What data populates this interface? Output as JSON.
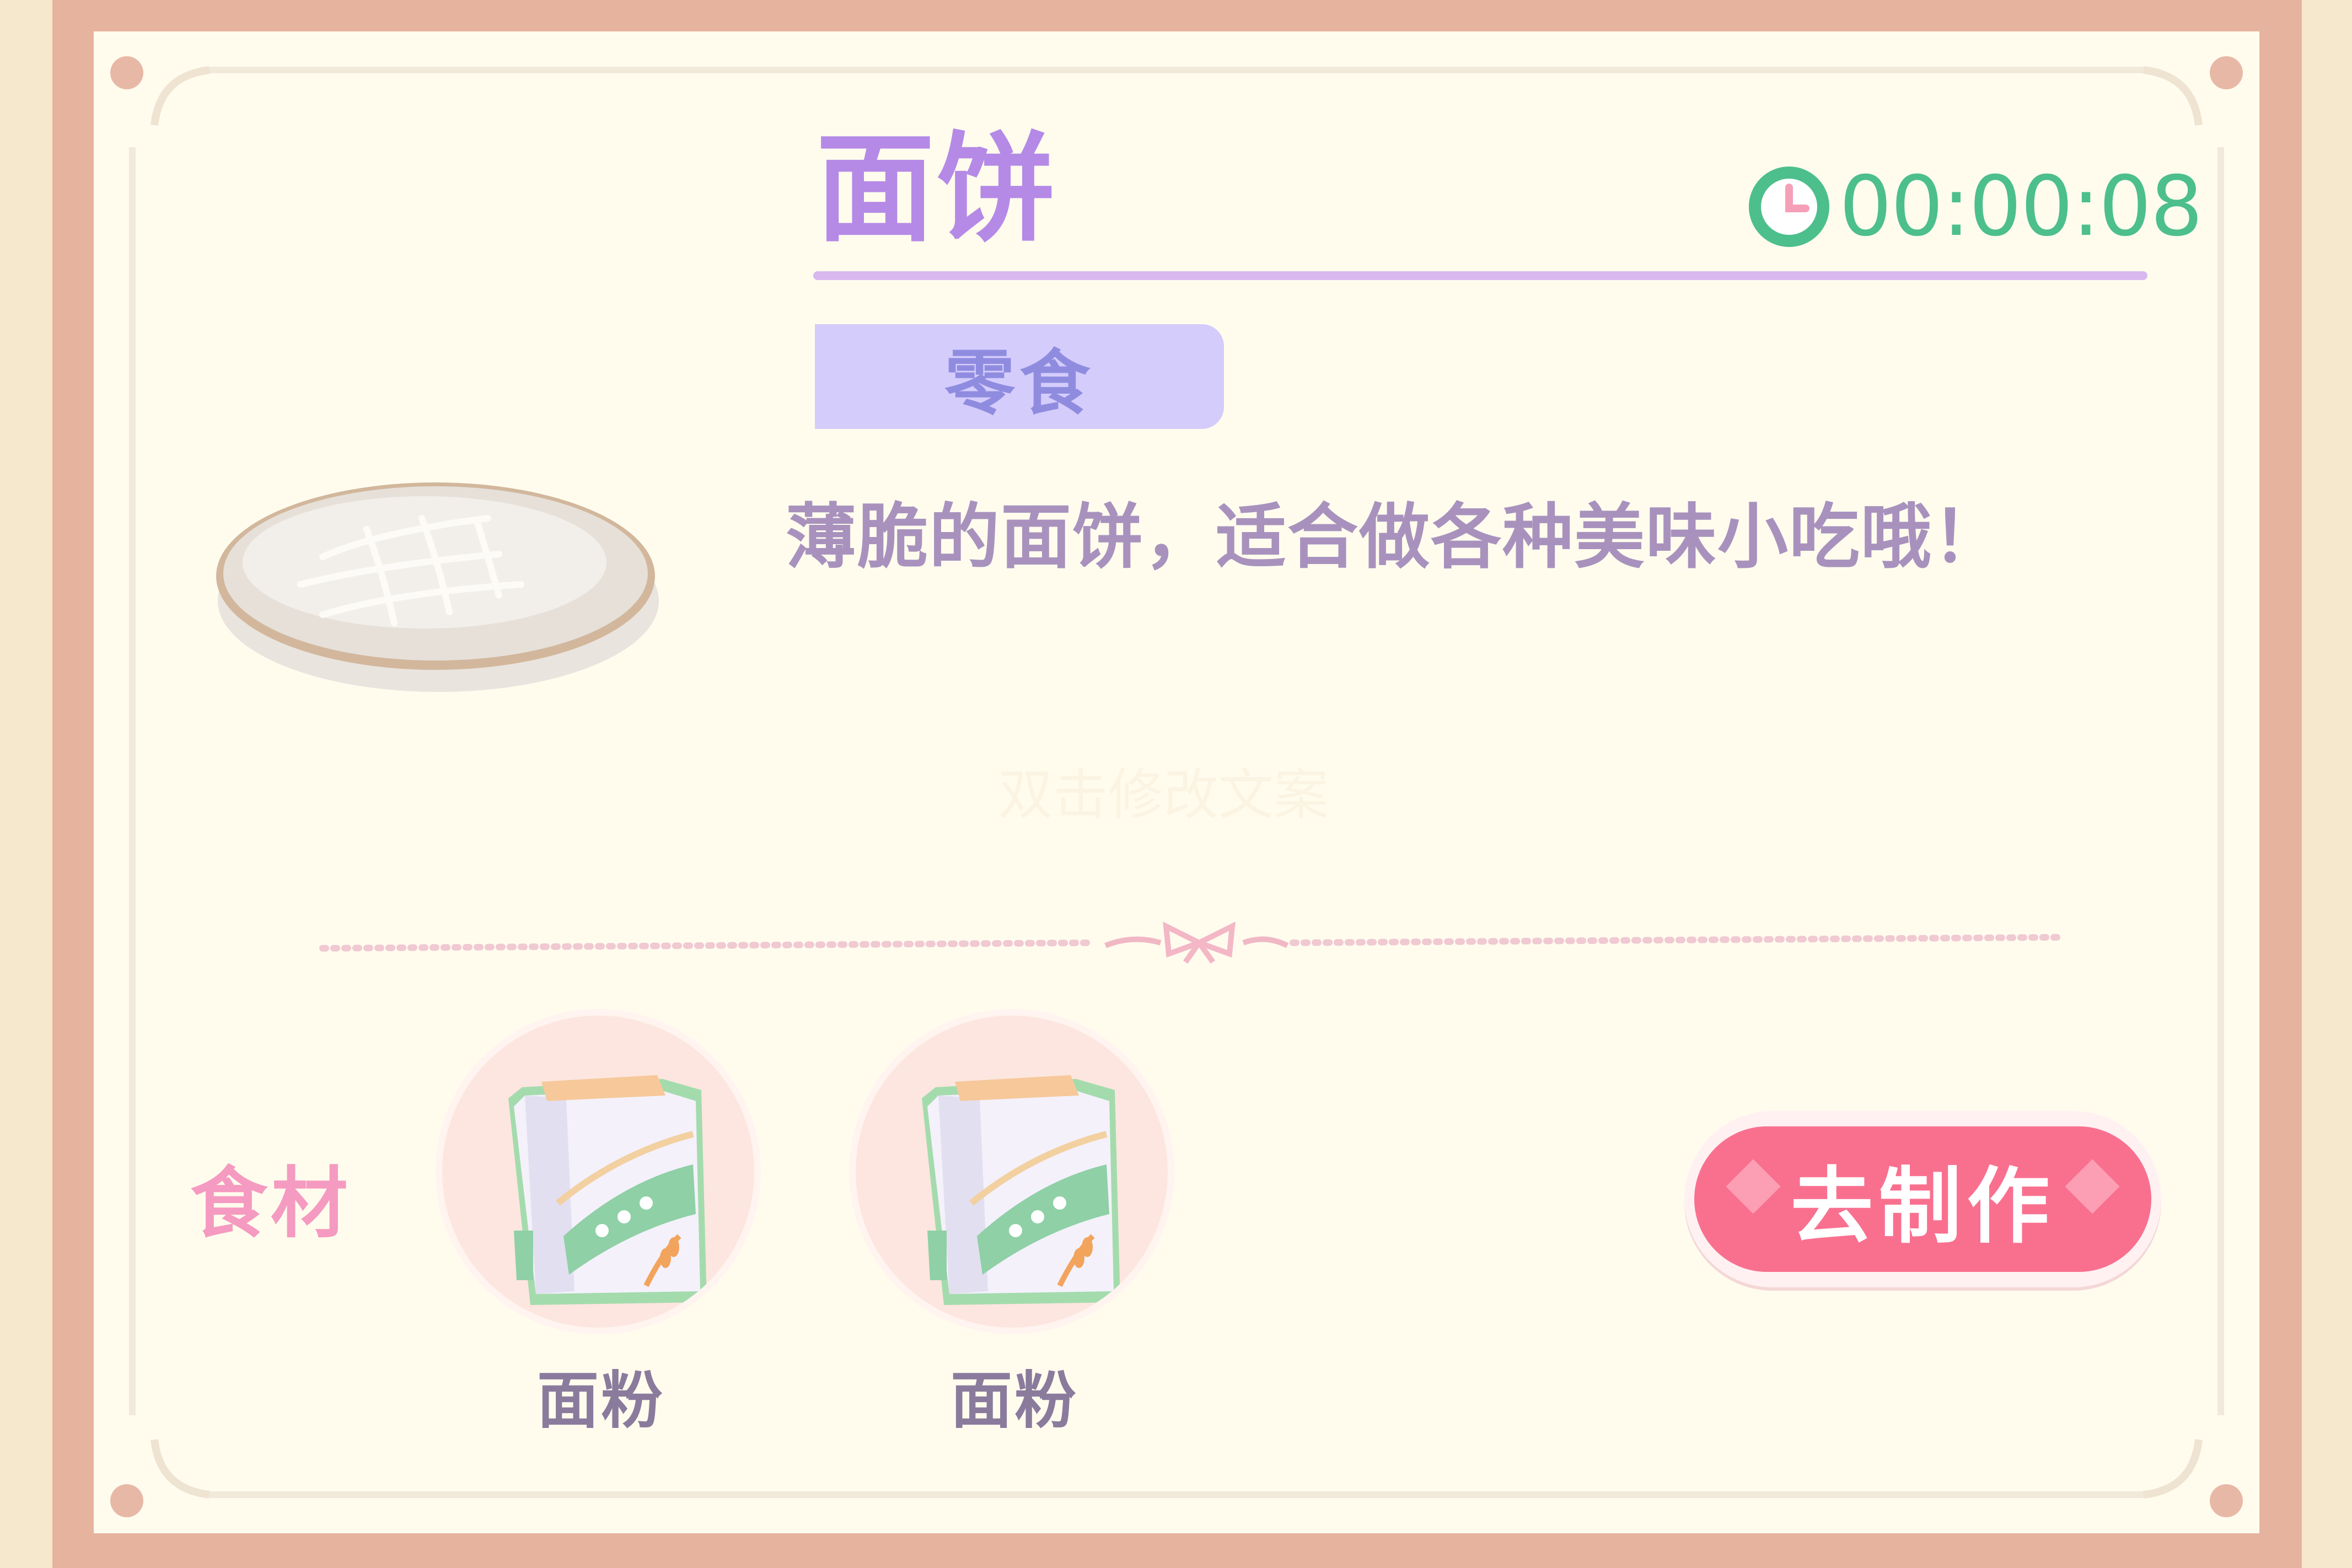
{
  "recipe": {
    "title": "面饼",
    "timer": "00:00:08",
    "category": "零食",
    "description": "薄脆的面饼，适合做各种美味小吃哦！",
    "watermark": "双击修改文案"
  },
  "ingredients": {
    "label": "食材",
    "items": [
      {
        "name": "面粉",
        "icon": "flour-bag-icon"
      },
      {
        "name": "面粉",
        "icon": "flour-bag-icon"
      }
    ]
  },
  "actions": {
    "make_label": "去制作"
  },
  "colors": {
    "frame": "#e6b39f",
    "card": "#fffcee",
    "title": "#b58ae6",
    "timer": "#4cbf8c",
    "tag": "#d4ccfb",
    "button": "#f9708f",
    "ingredient_label": "#f59ac0"
  }
}
